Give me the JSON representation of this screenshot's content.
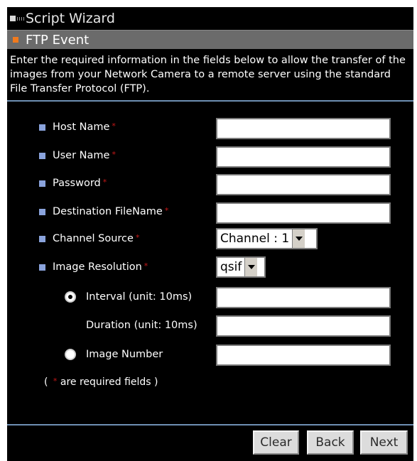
{
  "window": {
    "title": "Script Wizard"
  },
  "section": {
    "title": "FTP Event"
  },
  "intro": "Enter the required information in the fields below to allow the transfer of the images from your Network Camera to a remote server using the standard File Transfer Protocol (FTP).",
  "fields": {
    "host_name": {
      "label": "Host Name",
      "required_mark": "*",
      "value": ""
    },
    "user_name": {
      "label": "User Name",
      "required_mark": "*",
      "value": ""
    },
    "password": {
      "label": "Password",
      "required_mark": "*",
      "value": ""
    },
    "destination_filename": {
      "label": "Destination FileName",
      "required_mark": "*",
      "value": ""
    },
    "channel_source": {
      "label": "Channel Source",
      "required_mark": "*",
      "selected": "Channel : 1"
    },
    "image_resolution": {
      "label": "Image Resolution",
      "required_mark": "*",
      "selected": "qsif"
    },
    "interval": {
      "label": "Interval (unit: 10ms)",
      "value": ""
    },
    "duration": {
      "label": "Duration (unit: 10ms)",
      "value": ""
    },
    "image_number": {
      "label": "Image Number",
      "value": ""
    }
  },
  "radio": {
    "selected": "interval"
  },
  "note": {
    "prefix": "( ",
    "mark": "*",
    "suffix": " are required fields )"
  },
  "buttons": {
    "clear": "Clear",
    "back": "Back",
    "next": "Next"
  },
  "colors": {
    "background": "#000000",
    "section_bar": "#6b6b6b",
    "section_icon": "#f07a1e",
    "bullet": "#8aa3dc",
    "separator": "#6e8fb3",
    "required": "#c81818"
  },
  "icons": {
    "title": "window-grip-icon",
    "section": "orange-square-icon",
    "bullet": "blue-square-bullet-icon",
    "dropdown": "chevron-down-icon"
  }
}
